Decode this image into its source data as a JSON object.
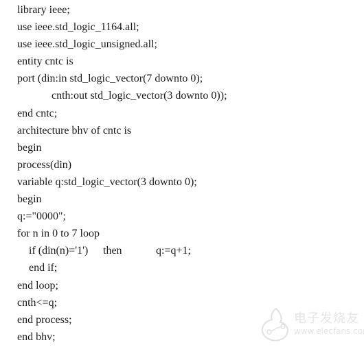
{
  "code_lines": [
    "library ieee;",
    "use ieee.std_logic_1164.all;",
    "use ieee.std_logic_unsigned.all;",
    "entity cntc is",
    "port (din:in std_logic_vector(7 downto 0);",
    "cnth:out std_logic_vector(3 downto 0));",
    "end cntc;",
    "architecture bhv of cntc is",
    "begin",
    "process(din)",
    "variable q:std_logic_vector(3 downto 0);",
    "begin",
    "q:=\"0000\";",
    "for n in 0 to 7 loop",
    "if (din(n)='1')",
    "end if;",
    "end loop;",
    "cnth<=q;",
    "end process;",
    "end bhv;"
  ],
  "if_line": {
    "condition": "if (din(n)='1')",
    "then": "then",
    "statement": "q:=q+1;"
  },
  "watermark": {
    "logo_icon": "elecfans-logo-icon",
    "name_cn": "电子发烧友",
    "url": "www.elecfans.com"
  }
}
